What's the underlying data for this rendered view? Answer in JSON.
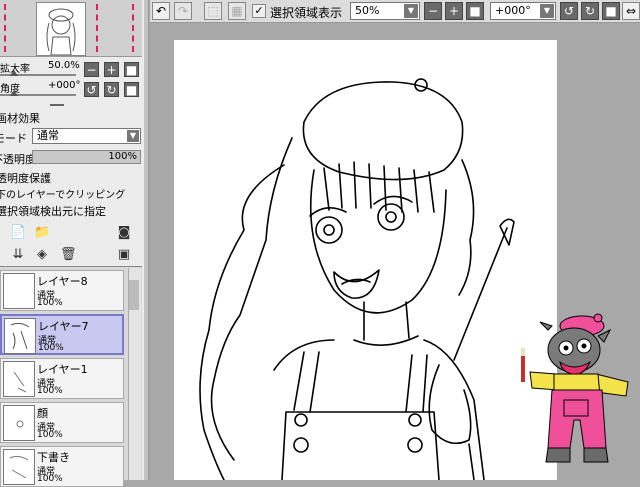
{
  "navigator": {
    "scale_label": "拡大率",
    "scale_value": "50.0%",
    "rotate_label": "角度",
    "rotate_value": "+000°"
  },
  "material": {
    "title": "画材効果",
    "mode_label": "モード",
    "mode_value": "通常",
    "opacity_label": "不透明度",
    "opacity_value": "100%",
    "opacity_level": 1.0,
    "options": [
      "透明度保護",
      "下のレイヤーでクリッピング",
      "選択領域検出元に指定"
    ]
  },
  "layers": [
    {
      "name": "レイヤー8",
      "mode": "通常",
      "opacity": "100%",
      "selected": false
    },
    {
      "name": "レイヤー7",
      "mode": "通常",
      "opacity": "100%",
      "selected": true
    },
    {
      "name": "レイヤー1",
      "mode": "通常",
      "opacity": "100%",
      "selected": false
    },
    {
      "name": "顔",
      "mode": "通常",
      "opacity": "100%",
      "selected": false
    },
    {
      "name": "下書き",
      "mode": "通常",
      "opacity": "100%",
      "selected": false
    }
  ],
  "toolbar": {
    "selection_display_label": "選択領域表示",
    "selection_display_checked": true,
    "zoom_value": "50%",
    "angle_value": "+000°"
  },
  "colors": {
    "accent_red": "#e02060",
    "selected_layer": "#c8c8f0",
    "canvas_bg": "#a8a8a8"
  }
}
